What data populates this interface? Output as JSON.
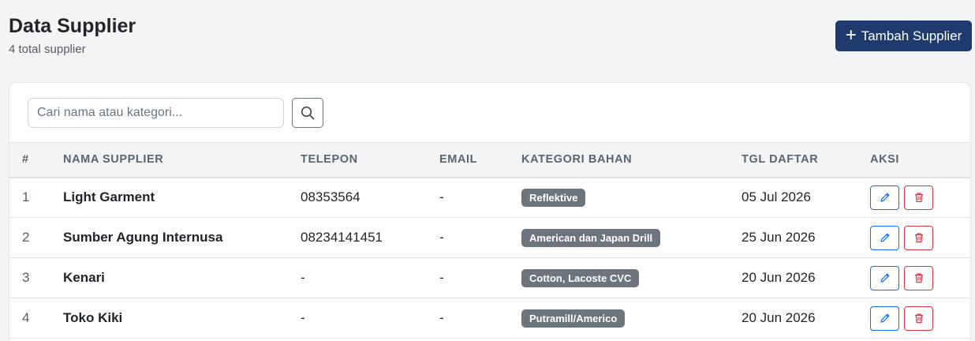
{
  "header": {
    "title": "Data Supplier",
    "subtitle": "4 total supplier",
    "add_button_label": "Tambah Supplier"
  },
  "search": {
    "placeholder": "Cari nama atau kategori..."
  },
  "table": {
    "columns": [
      "#",
      "NAMA SUPPLIER",
      "TELEPON",
      "EMAIL",
      "KATEGORI BAHAN",
      "TGL DAFTAR",
      "AKSI"
    ],
    "rows": [
      {
        "num": "1",
        "name": "Light Garment",
        "phone": "08353564",
        "email": "-",
        "category": "Reflektive",
        "date": "05 Jul 2026"
      },
      {
        "num": "2",
        "name": "Sumber Agung Internusa",
        "phone": "08234141451",
        "email": "-",
        "category": "American dan Japan Drill",
        "date": "25 Jun 2026"
      },
      {
        "num": "3",
        "name": "Kenari",
        "phone": "-",
        "email": "-",
        "category": "Cotton, Lacoste CVC",
        "date": "20 Jun 2026"
      },
      {
        "num": "4",
        "name": "Toko Kiki",
        "phone": "-",
        "email": "-",
        "category": "Putramill/Americo",
        "date": "20 Jun 2026"
      }
    ],
    "row_actions": [
      {
        "icon": "pencil-icon",
        "color": "#0d6efd"
      },
      {
        "icon": "trash-icon",
        "color": "#dc3545"
      }
    ]
  },
  "colors": {
    "primary": "#1e3a6e",
    "badge": "#6c757d",
    "edit": "#0d6efd",
    "delete": "#dc3545"
  }
}
